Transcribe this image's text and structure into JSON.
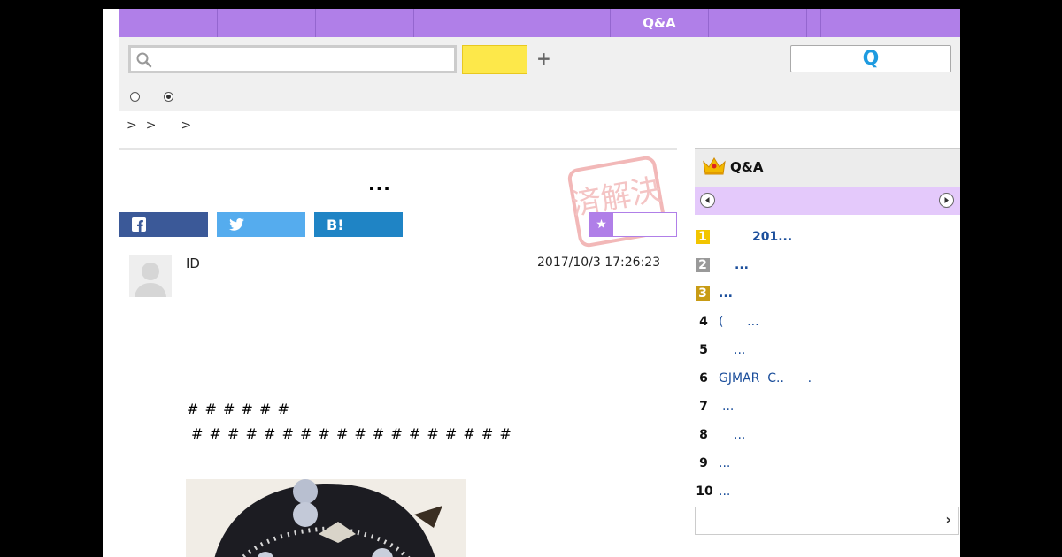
{
  "topnav": {
    "tabs": [
      "",
      "",
      "",
      "",
      "",
      "Q&A",
      "",
      "",
      ""
    ]
  },
  "search": {
    "value": "",
    "placeholder": "",
    "button_label": "",
    "plus": "+",
    "q_label": "Q"
  },
  "breadcrumb": [
    ">",
    ">",
    ">"
  ],
  "article": {
    "title": "...",
    "user_id": "ID",
    "timestamp": "2017/10/3  17:26:23",
    "hashes_line1": "# # # # # #",
    "hashes_line2": "# # # # # # # # # # # # # # # # # #"
  },
  "share": {
    "fb": "",
    "tw": "",
    "hb": "B!"
  },
  "stamp_text": "済解決",
  "sidebar": {
    "title": "Q&A",
    "ranking": [
      {
        "num": "1",
        "text": "201...",
        "bold": true
      },
      {
        "num": "2",
        "text": "...",
        "bold": true
      },
      {
        "num": "3",
        "text": "...",
        "bold": true
      },
      {
        "num": "4",
        "text": "(      ...",
        "bold": false
      },
      {
        "num": "5",
        "text": "...",
        "bold": false
      },
      {
        "num": "6",
        "text": "GJMAR  C..      .",
        "bold": false
      },
      {
        "num": "7",
        "text": "...",
        "bold": false
      },
      {
        "num": "8",
        "text": "...",
        "bold": false
      },
      {
        "num": "9",
        "text": "...",
        "bold": false
      },
      {
        "num": "10",
        "text": "...",
        "bold": false
      }
    ],
    "more_arrow": "›"
  },
  "colors": {
    "accent": "#b07fe8",
    "search_button": "#fde84a",
    "link": "#1b4e9b"
  }
}
